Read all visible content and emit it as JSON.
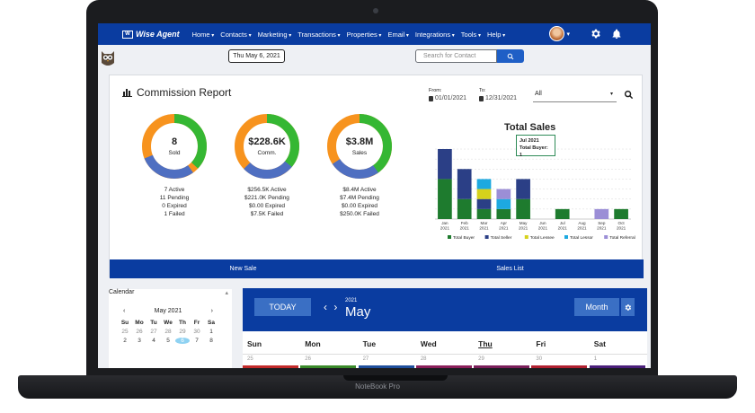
{
  "device": {
    "label": "NoteBook Pro"
  },
  "nav": {
    "logo": "Wise Agent",
    "items": [
      "Home",
      "Contacts",
      "Marketing",
      "Transactions",
      "Properties",
      "Email",
      "Integrations",
      "Tools",
      "Help"
    ]
  },
  "subbar": {
    "date": "Thu May 6, 2021",
    "search_placeholder": "Search for Contact"
  },
  "report": {
    "title": "Commission Report",
    "from_label": "From:",
    "from_value": "01/01/2021",
    "to_label": "To:",
    "to_value": "12/31/2021",
    "filter_value": "All",
    "donuts": [
      {
        "value": "8",
        "label": "Sold",
        "stats": [
          "7 Active",
          "11 Pending",
          "0 Expired",
          "1 Failed"
        ]
      },
      {
        "value": "$228.6K",
        "label": "Comm.",
        "stats": [
          "$256.5K Active",
          "$221.0K Pending",
          "$0.00 Expired",
          "$7.5K Failed"
        ]
      },
      {
        "value": "$3.8M",
        "label": "Sales",
        "stats": [
          "$8.4M Active",
          "$7.4M Pending",
          "$0.00 Expired",
          "$250.0K Failed"
        ]
      }
    ],
    "footer": {
      "new_sale": "New Sale",
      "sales_list": "Sales List"
    },
    "tooltip": {
      "title": "Jul 2021",
      "line": "Total Buyer: 1"
    }
  },
  "chart_data": {
    "type": "bar",
    "title": "Total Sales",
    "categories": [
      "Jan 2021",
      "Feb 2021",
      "Mar 2021",
      "Apr 2021",
      "May 2021",
      "Jun 2021",
      "Jul 2021",
      "Aug 2021",
      "Sep 2021",
      "Oct 2021"
    ],
    "ylim": [
      0,
      7
    ],
    "series": [
      {
        "name": "Total Buyer",
        "color": "#1e7b2e",
        "values": [
          4,
          2,
          1,
          1,
          2,
          0,
          1,
          0,
          0,
          1
        ]
      },
      {
        "name": "Total Seller",
        "color": "#2b3f86",
        "values": [
          3,
          3,
          1,
          0,
          2,
          0,
          0,
          0,
          0,
          0
        ]
      },
      {
        "name": "Total Lessee",
        "color": "#d6d21c",
        "values": [
          0,
          0,
          1,
          0,
          0,
          0,
          0,
          0,
          0,
          0
        ]
      },
      {
        "name": "Total Lessor",
        "color": "#1da9e0",
        "values": [
          0,
          0,
          1,
          1,
          0,
          0,
          0,
          0,
          0,
          0
        ]
      },
      {
        "name": "Total Referral",
        "color": "#9b8ed6",
        "values": [
          0,
          0,
          0,
          1,
          0,
          0,
          0,
          0,
          1,
          0
        ]
      }
    ],
    "legend": "bottom"
  },
  "mini_cal": {
    "title": "Calendar",
    "month": "May 2021",
    "dow": [
      "Su",
      "Mo",
      "Tu",
      "We",
      "Th",
      "Fr",
      "Sa"
    ],
    "rows": [
      [
        "25",
        "26",
        "27",
        "28",
        "29",
        "30",
        "1"
      ],
      [
        "2",
        "3",
        "4",
        "5",
        "6",
        "7",
        "8"
      ]
    ],
    "today": "6"
  },
  "big_cal": {
    "today_label": "TODAY",
    "year": "2021",
    "month": "May",
    "view_label": "Month",
    "dow": [
      "Sun",
      "Mon",
      "Tue",
      "Wed",
      "Thu",
      "Fri",
      "Sat"
    ],
    "day_nums": [
      "25",
      "26",
      "27",
      "28",
      "29",
      "30",
      "1"
    ],
    "event_colors": [
      "#c22a2a",
      "#3a8a2a",
      "#1f4f9c",
      "#8a1f5a",
      "#7a1f5a",
      "#b02030",
      "#4a1f7a"
    ]
  }
}
